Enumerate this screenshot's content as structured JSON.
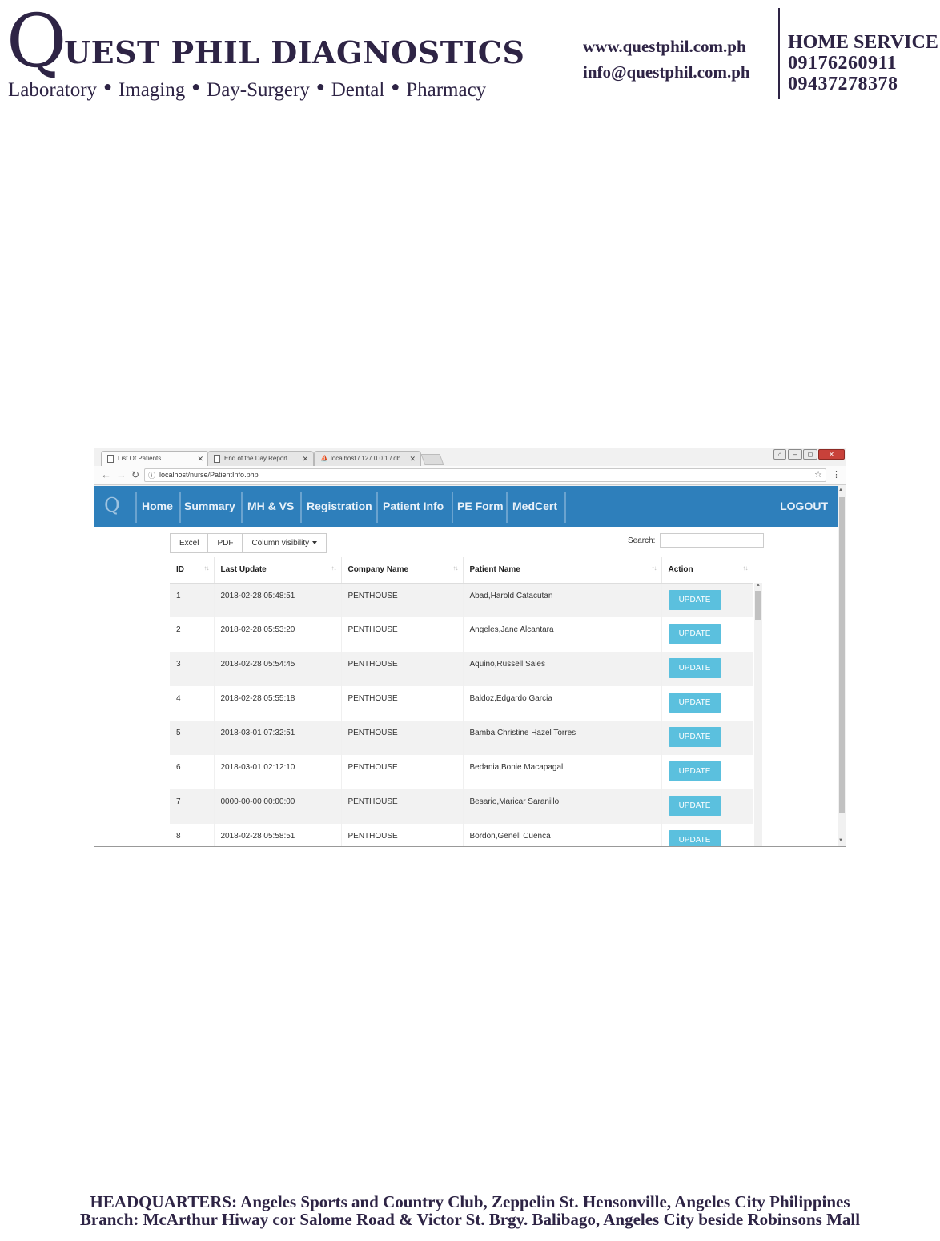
{
  "letterhead": {
    "logo_letter": "Q",
    "company_name": "UEST PHIL DIAGNOSTICS",
    "services": [
      "Laboratory",
      "Imaging",
      "Day-Surgery",
      "Dental",
      "Pharmacy"
    ],
    "website": "www.questphil.com.ph",
    "email": "info@questphil.com.ph",
    "home_service_title": "HOME SERVICE",
    "phones": [
      "09176260911",
      "09437278378"
    ]
  },
  "browser": {
    "tabs": [
      {
        "title": "List Of Patients",
        "active": true
      },
      {
        "title": "End of the Day Report",
        "active": false
      },
      {
        "title": "localhost / 127.0.0.1 / db",
        "active": false
      }
    ],
    "url": "localhost/nurse/PatientInfo.php"
  },
  "app": {
    "logo": "Q",
    "nav": [
      "Home",
      "Summary",
      "MH & VS",
      "Registration",
      "Patient Info",
      "PE Form",
      "MedCert"
    ],
    "logout": "LOGOUT"
  },
  "toolbar": {
    "excel": "Excel",
    "pdf": "PDF",
    "column_visibility": "Column visibility",
    "search_label": "Search:"
  },
  "table": {
    "headers": [
      "ID",
      "Last Update",
      "Company Name",
      "Patient Name",
      "Action"
    ],
    "rows": [
      {
        "id": "1",
        "last_update": "2018-02-28 05:48:51",
        "company": "PENTHOUSE",
        "patient": "Abad,Harold Catacutan",
        "action": "UPDATE"
      },
      {
        "id": "2",
        "last_update": "2018-02-28 05:53:20",
        "company": "PENTHOUSE",
        "patient": "Angeles,Jane Alcantara",
        "action": "UPDATE"
      },
      {
        "id": "3",
        "last_update": "2018-02-28 05:54:45",
        "company": "PENTHOUSE",
        "patient": "Aquino,Russell Sales",
        "action": "UPDATE"
      },
      {
        "id": "4",
        "last_update": "2018-02-28 05:55:18",
        "company": "PENTHOUSE",
        "patient": "Baldoz,Edgardo Garcia",
        "action": "UPDATE"
      },
      {
        "id": "5",
        "last_update": "2018-03-01 07:32:51",
        "company": "PENTHOUSE",
        "patient": "Bamba,Christine Hazel Torres",
        "action": "UPDATE"
      },
      {
        "id": "6",
        "last_update": "2018-03-01 02:12:10",
        "company": "PENTHOUSE",
        "patient": "Bedania,Bonie Macapagal",
        "action": "UPDATE"
      },
      {
        "id": "7",
        "last_update": "0000-00-00 00:00:00",
        "company": "PENTHOUSE",
        "patient": "Besario,Maricar Saranillo",
        "action": "UPDATE"
      },
      {
        "id": "8",
        "last_update": "2018-02-28 05:58:51",
        "company": "PENTHOUSE",
        "patient": "Bordon,Genell Cuenca",
        "action": "UPDATE"
      }
    ]
  },
  "footer": {
    "line1": "HEADQUARTERS: Angeles Sports and Country Club, Zeppelin St. Hensonville, Angeles City Philippines",
    "line2": "Branch: McArthur Hiway cor Salome Road & Victor St. Brgy. Balibago, Angeles City beside Robinsons Mall"
  },
  "colors": {
    "brand_text": "#2e2445",
    "nav_bg": "#2e7fbb",
    "update_button": "#5bc0de"
  }
}
